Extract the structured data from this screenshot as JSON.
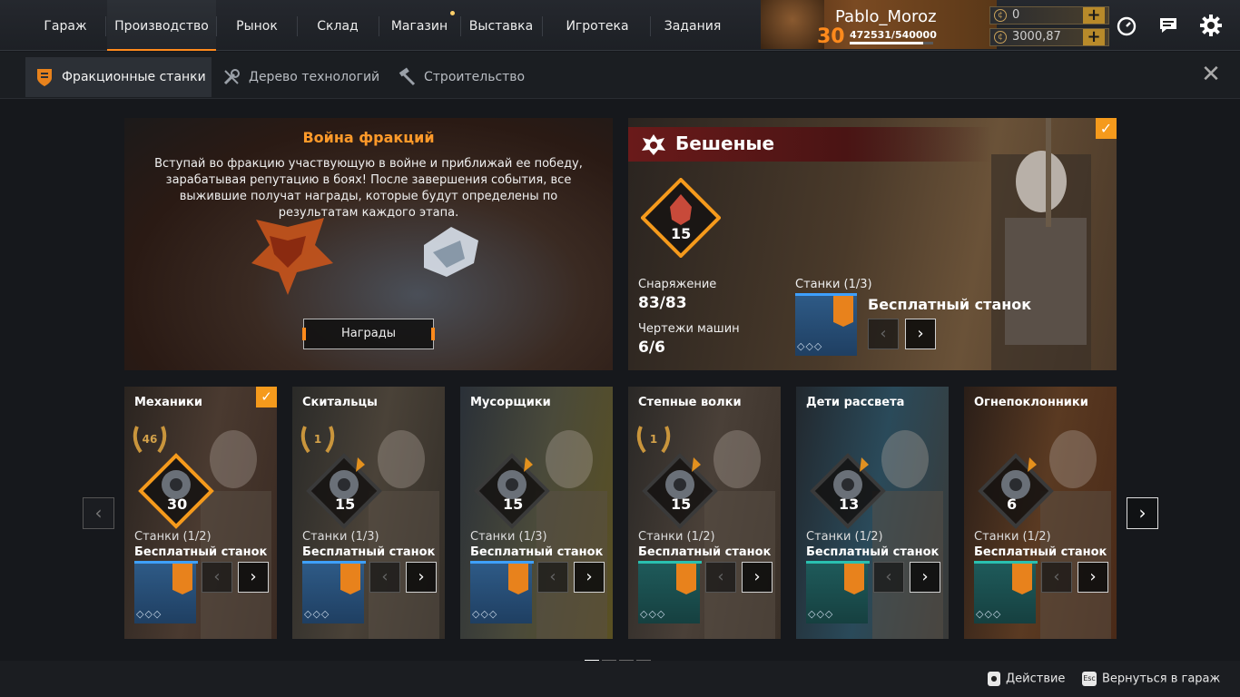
{
  "nav": {
    "items": [
      "Гараж",
      "Производство",
      "Рынок",
      "Склад",
      "Магазин",
      "Выставка",
      "Игротека",
      "Задания"
    ],
    "active": "Производство"
  },
  "profile": {
    "name": "Pablo_Moroz",
    "level": "30",
    "xp": "472531/540000",
    "xp_progress": 0.875
  },
  "currency": {
    "coins": "0",
    "credits": "3000,87"
  },
  "icons": {
    "speed": "speedometer-icon",
    "chat": "chat-icon",
    "settings": "gear-icon"
  },
  "subnav": {
    "tabs": [
      "Фракционные станки",
      "Дерево технологий",
      "Строительство"
    ],
    "active": "Фракционные станки"
  },
  "war": {
    "title": "Война фракций",
    "description": "Вступай во фракцию участвующую в войне и приближай ее победу, зарабатывая репутацию в боях! После завершения события, все выжившие получат награды, которые будут определены по результатам каждого этапа.",
    "rewards_button": "Награды"
  },
  "featured": {
    "name": "Бешеные",
    "level": "15",
    "equipment_label": "Снаряжение",
    "equipment_value": "83/83",
    "blueprints_label": "Чертежи машин",
    "blueprints_value": "6/6",
    "stations_label": "Станки (1/3)",
    "free_station": "Бесплатный станок",
    "page": 1,
    "pages": 3
  },
  "factions": [
    {
      "name": "Механики",
      "level": "30",
      "reputation": "46",
      "stations": "Станки (1/2)",
      "free": "Бесплатный станок",
      "selected": true,
      "bar": "#3ea0ff",
      "pages": 2
    },
    {
      "name": "Скитальцы",
      "level": "15",
      "reputation": "1",
      "stations": "Станки (1/3)",
      "free": "Бесплатный станок",
      "selected": false,
      "bar": "#3ea0ff",
      "pages": 3
    },
    {
      "name": "Мусорщики",
      "level": "15",
      "reputation": "",
      "stations": "Станки (1/3)",
      "free": "Бесплатный станок",
      "selected": false,
      "bar": "#3ea0ff",
      "pages": 3
    },
    {
      "name": "Степные волки",
      "level": "15",
      "reputation": "1",
      "stations": "Станки (1/2)",
      "free": "Бесплатный станок",
      "selected": false,
      "bar": "#2ac0b0",
      "pages": 2
    },
    {
      "name": "Дети рассвета",
      "level": "13",
      "reputation": "",
      "stations": "Станки (1/2)",
      "free": "Бесплатный станок",
      "selected": false,
      "bar": "#2ac0b0",
      "pages": 2
    },
    {
      "name": "Огнепоклонники",
      "level": "6",
      "reputation": "",
      "stations": "Станки (1/2)",
      "free": "Бесплатный станок",
      "selected": false,
      "bar": "#2ac0b0",
      "pages": 2
    }
  ],
  "footer": {
    "action": "Действие",
    "back_key": "Esc",
    "back": "Вернуться в гараж"
  },
  "colors": {
    "accent": "#ff8a1c",
    "check": "#f59a1c",
    "title": "#ff9a2a"
  }
}
